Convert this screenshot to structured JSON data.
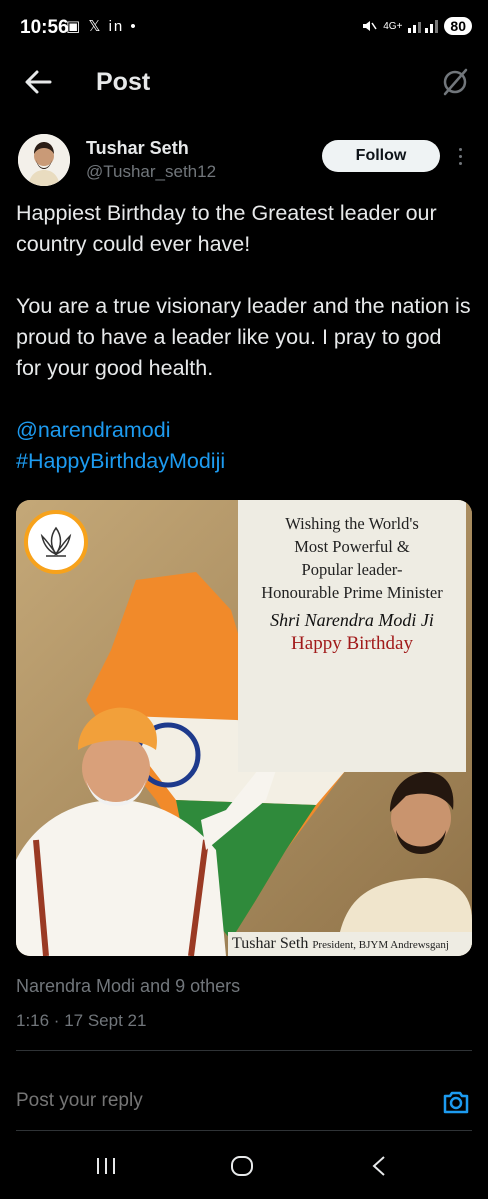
{
  "status_bar": {
    "time": "10:56",
    "notif_icons": "▣ 𝕏 in •",
    "network": "4G+",
    "battery": "80"
  },
  "header": {
    "title": "Post",
    "back_icon": "arrow-left-icon",
    "grok_icon": "grok-icon"
  },
  "author": {
    "name": "Tushar Seth",
    "handle": "@Tushar_seth12",
    "follow_label": "Follow"
  },
  "tweet": {
    "para1": "Happiest Birthday to the Greatest leader our country could ever have!",
    "para2": "You are a true visionary leader and the nation is proud to have a leader like you. I pray to god for your good health.",
    "mention": "@narendramodi",
    "hashtag": "#HappyBirthdayModiji"
  },
  "media": {
    "line1": "Wishing the World's",
    "line2": "Most Powerful &",
    "line3": "Popular leader-",
    "line4": "Honourable Prime Minister",
    "name": "Shri Narendra Modi Ji",
    "wish": "Happy Birthday",
    "footer_name": "Tushar Seth",
    "footer_title": "President, BJYM Andrewsganj"
  },
  "meta": {
    "likes": "Narendra Modi and 9 others",
    "timestamp": "1:16 · 17 Sept 21"
  },
  "reply": {
    "placeholder": "Post your reply"
  },
  "colors": {
    "background": "#000000",
    "text": "#e7e9ea",
    "muted": "#71767b",
    "link": "#1d9bf0"
  }
}
